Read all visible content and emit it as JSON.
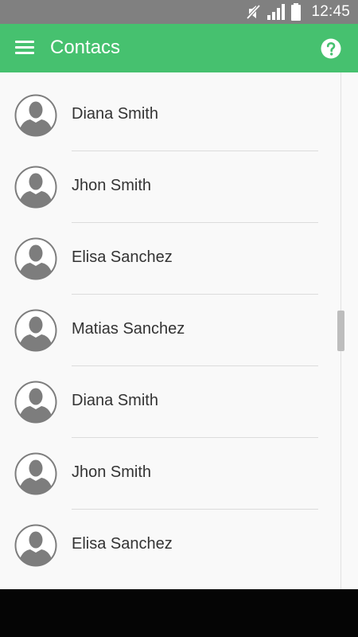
{
  "status_bar": {
    "time": "12:45",
    "icons": [
      "mute-icon",
      "signal-icon",
      "battery-icon"
    ],
    "background": "#808080"
  },
  "app_bar": {
    "title": "Contacs",
    "menu_icon": "menu-icon",
    "help_icon": "help-icon",
    "background": "#46c16f"
  },
  "contacts": [
    {
      "name": "Diana Smith"
    },
    {
      "name": "Jhon Smith"
    },
    {
      "name": "Elisa Sanchez"
    },
    {
      "name": "Matias Sanchez"
    },
    {
      "name": "Diana Smith"
    },
    {
      "name": "Jhon Smith"
    },
    {
      "name": "Elisa Sanchez"
    }
  ]
}
